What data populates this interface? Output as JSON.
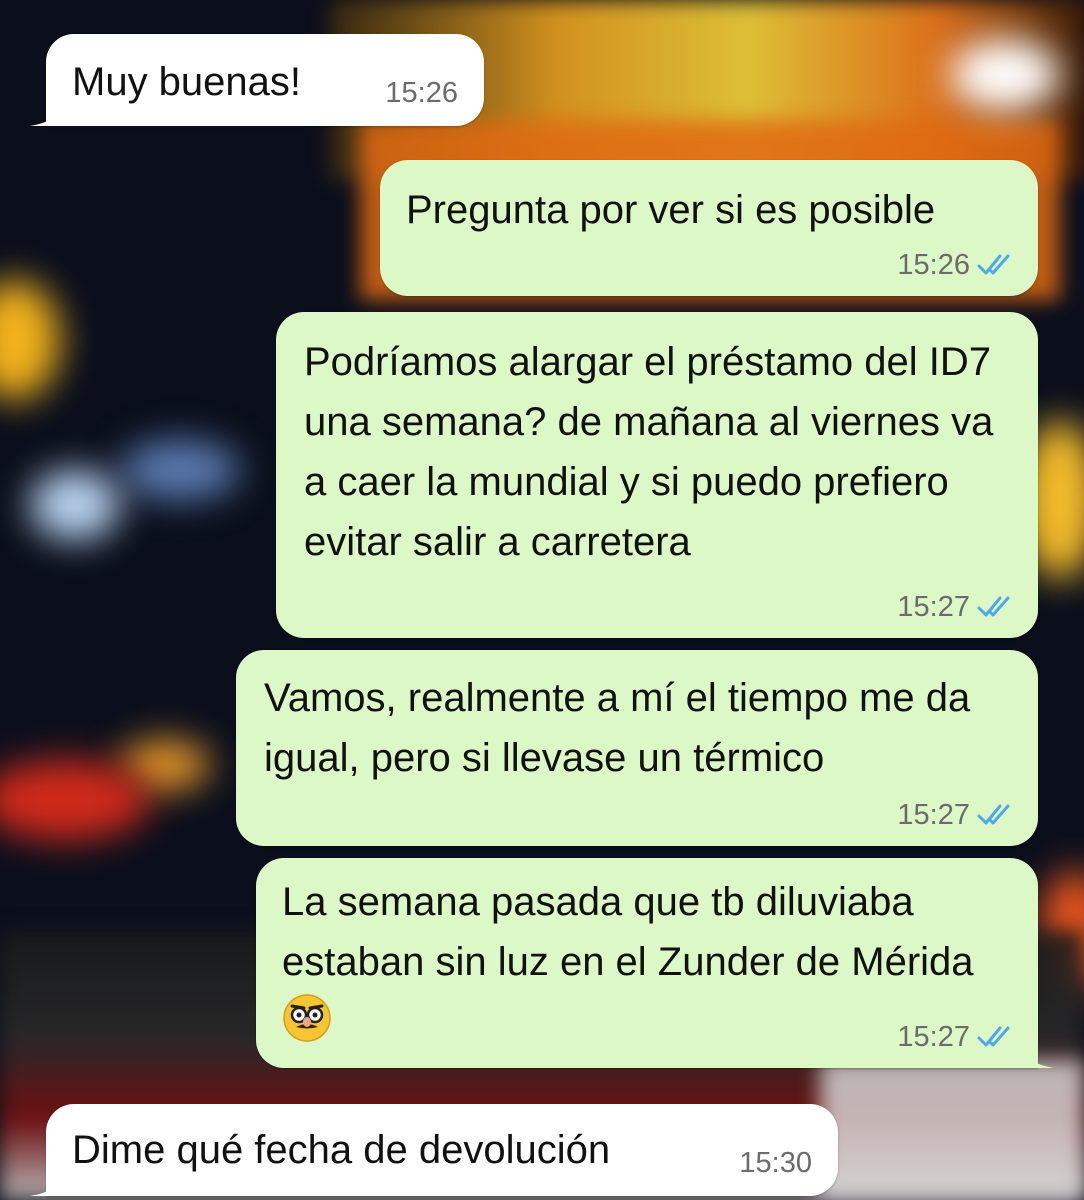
{
  "messages": [
    {
      "direction": "in",
      "text": "Muy buenas!",
      "time": "15:26",
      "status": ""
    },
    {
      "direction": "out",
      "text": "Pregunta por ver si es posible",
      "time": "15:26",
      "status": "read"
    },
    {
      "direction": "out",
      "text": "Podríamos alargar el préstamo del ID7 una semana? de mañana al viernes va a caer la mundial y si puedo prefiero evitar salir a carretera",
      "time": "15:27",
      "status": "read"
    },
    {
      "direction": "out",
      "text": "Vamos, realmente a mí el tiempo me da igual, pero si llevase un térmico",
      "time": "15:27",
      "status": "read"
    },
    {
      "direction": "out",
      "text": "La semana pasada que tb diluviaba estaban sin luz en el Zunder de Mérida",
      "emoji": "disguised-face-emoji",
      "time": "15:27",
      "status": "read"
    },
    {
      "direction": "in",
      "text": "Dime qué fecha de devolución",
      "time": "15:30",
      "status": ""
    }
  ],
  "colors": {
    "incoming_bubble": "#ffffff",
    "outgoing_bubble": "#dcf8c6",
    "read_tick": "#4fa8e8",
    "timestamp": "#6b6b6b"
  },
  "icons": {
    "read_receipt": "double-check-icon",
    "emoji": "disguised-face-emoji"
  }
}
